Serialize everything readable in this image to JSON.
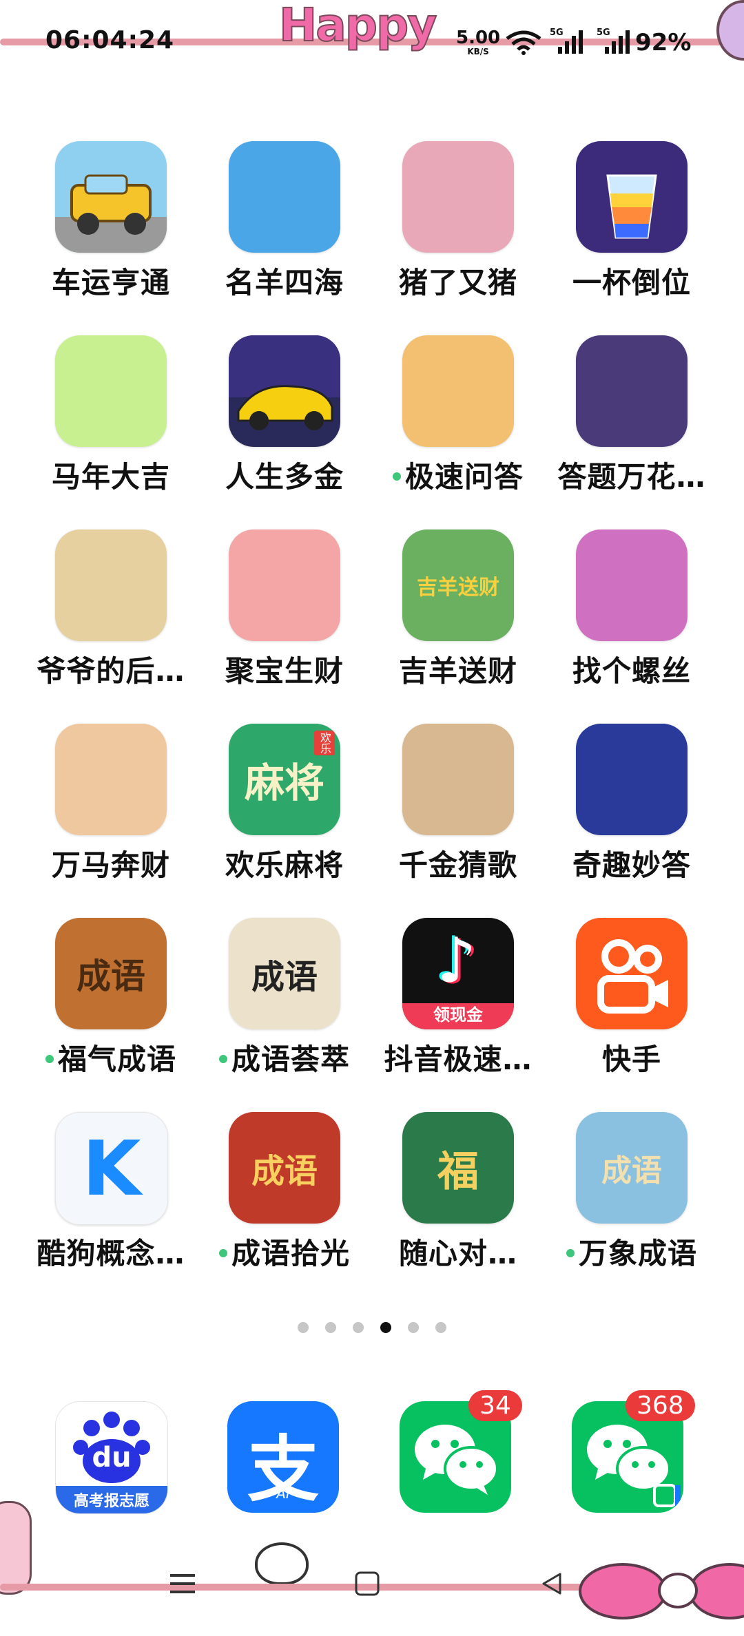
{
  "status_bar": {
    "time": "06:04:24",
    "net_speed": "5.00",
    "net_unit": "KB/S",
    "sim1": "5G",
    "sim2": "5G",
    "battery": "92%"
  },
  "decoration": {
    "banner_text": "Happy"
  },
  "apps": [
    {
      "label": "车运亨通",
      "dot": false,
      "icon": "truck-icon",
      "bg": "#8fd0f0"
    },
    {
      "label": "名羊四海",
      "dot": false,
      "icon": "sheep-icon",
      "bg": "#4aa6e6"
    },
    {
      "label": "猪了又猪",
      "dot": false,
      "icon": "pig-icon",
      "bg": "#e8a8b8"
    },
    {
      "label": "一杯倒位",
      "dot": false,
      "icon": "cup-icon",
      "bg": "#3c2a7a"
    },
    {
      "label": "马年大吉",
      "dot": false,
      "icon": "horse-icon",
      "bg": "#c8f090"
    },
    {
      "label": "人生多金",
      "dot": false,
      "icon": "car-icon",
      "bg": "#2a2a5a"
    },
    {
      "label": "极速问答",
      "dot": true,
      "icon": "girl-icon",
      "bg": "#f2c070"
    },
    {
      "label": "答题万花…",
      "dot": false,
      "icon": "kaleidoscope-icon",
      "bg": "#4a3a7a"
    },
    {
      "label": "爷爷的后…",
      "dot": false,
      "icon": "grandpa-icon",
      "bg": "#e6d0a0"
    },
    {
      "label": "聚宝生财",
      "dot": false,
      "icon": "fortune-god-icon",
      "bg": "#f4a6a6"
    },
    {
      "label": "吉羊送财",
      "dot": false,
      "icon": "lucky-sheep-icon",
      "bg": "#6ab060"
    },
    {
      "label": "找个螺丝",
      "dot": false,
      "icon": "witch-icon",
      "bg": "#d070c0"
    },
    {
      "label": "万马奔财",
      "dot": false,
      "icon": "pony-icon",
      "bg": "#f0c8a0"
    },
    {
      "label": "欢乐麻将",
      "dot": false,
      "icon": "mahjong-icon",
      "bg": "#2ea86a"
    },
    {
      "label": "千金猜歌",
      "dot": false,
      "icon": "dancer-icon",
      "bg": "#d8b890"
    },
    {
      "label": "奇趣妙答",
      "dot": false,
      "icon": "pencil-boy-icon",
      "bg": "#2a3a9a"
    },
    {
      "label": "福气成语",
      "dot": true,
      "icon": "scroll-icon",
      "bg": "#c07030"
    },
    {
      "label": "成语荟萃",
      "dot": true,
      "icon": "sage-icon",
      "bg": "#ece2cc"
    },
    {
      "label": "抖音极速…",
      "dot": false,
      "icon": "tiktok-icon",
      "bg": "#111111"
    },
    {
      "label": "快手",
      "dot": false,
      "icon": "kuaishou-icon",
      "bg": "#ff5a1e"
    },
    {
      "label": "酷狗概念…",
      "dot": false,
      "icon": "kugou-icon",
      "bg": "#f4f7fb"
    },
    {
      "label": "成语拾光",
      "dot": true,
      "icon": "books-icon",
      "bg": "#c03a2a"
    },
    {
      "label": "随心对…",
      "dot": false,
      "icon": "tiles-icon",
      "bg": "#2a7a4a"
    },
    {
      "label": "万象成语",
      "dot": true,
      "icon": "book-icon",
      "bg": "#8ac0e0"
    }
  ],
  "icon_text": {
    "mahjong": "麻将",
    "mahjong_tag": "欢乐",
    "scroll": "成语",
    "sage": "成语",
    "books": "成语",
    "tiles": "福",
    "book": "成语",
    "tiktok_tag": "领现金",
    "lucky_sheep": "吉羊送财",
    "kugou": "K"
  },
  "pager": {
    "pages": 6,
    "active": 4
  },
  "dock": [
    {
      "name": "baidu",
      "icon": "baidu-paw-icon",
      "caption": "du",
      "sub": "高考报志愿",
      "badge": null
    },
    {
      "name": "alipay",
      "icon": "alipay-icon",
      "caption": "支",
      "sub": "AI",
      "badge": null
    },
    {
      "name": "wechat",
      "icon": "wechat-icon",
      "badge": "34"
    },
    {
      "name": "wechat-clone",
      "icon": "wechat-icon",
      "badge": "368"
    }
  ],
  "colors": {
    "accent_green": "#07c160",
    "badge_red": "#ea3a3a",
    "dot_green": "#3ec67a",
    "alipay_blue": "#1677ff",
    "baidu_blue": "#2932e1"
  }
}
